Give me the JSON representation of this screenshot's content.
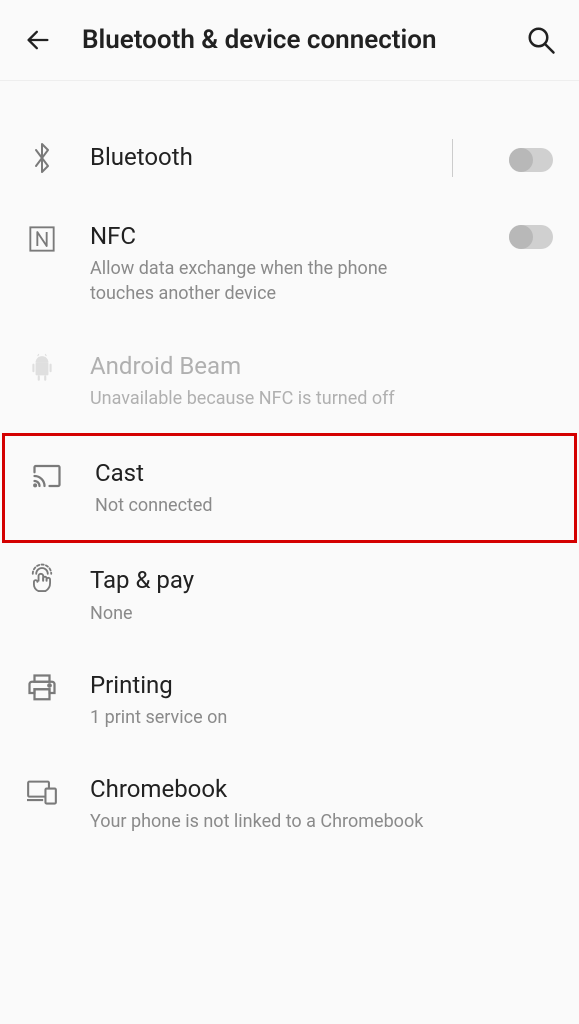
{
  "header": {
    "title": "Bluetooth & device connection"
  },
  "items": {
    "bluetooth": {
      "title": "Bluetooth"
    },
    "nfc": {
      "title": "NFC",
      "sub": "Allow data exchange when the phone touches another device"
    },
    "beam": {
      "title": "Android Beam",
      "sub": "Unavailable because NFC is turned off"
    },
    "cast": {
      "title": "Cast",
      "sub": "Not connected"
    },
    "tappay": {
      "title": "Tap & pay",
      "sub": "None"
    },
    "printing": {
      "title": "Printing",
      "sub": "1 print service on"
    },
    "chromebook": {
      "title": "Chromebook",
      "sub": "Your phone is not linked to a Chromebook"
    }
  }
}
